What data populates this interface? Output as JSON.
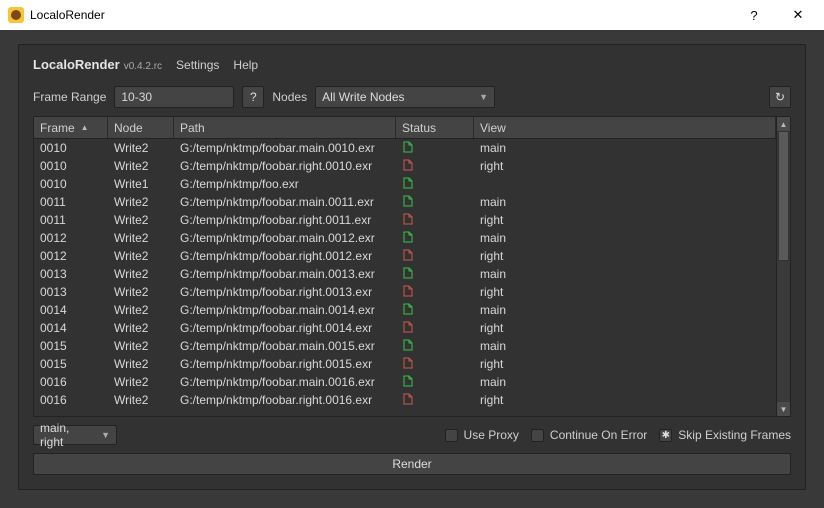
{
  "window": {
    "title": "LocaloRender"
  },
  "header": {
    "app_name": "LocaloRender",
    "version": "v0.4.2.rc",
    "menus": {
      "settings": "Settings",
      "help": "Help"
    }
  },
  "controls": {
    "frame_range_label": "Frame Range",
    "frame_range_value": "10-30",
    "help_glyph": "?",
    "nodes_label": "Nodes",
    "nodes_value": "All Write Nodes",
    "refresh_glyph": "↻"
  },
  "columns": {
    "frame": "Frame",
    "node": "Node",
    "path": "Path",
    "status": "Status",
    "view": "View"
  },
  "rows": [
    {
      "frame": "0010",
      "node": "Write2",
      "path": "G:/temp/nktmp/foobar.main.0010.exr",
      "status": "ok",
      "view": "main"
    },
    {
      "frame": "0010",
      "node": "Write2",
      "path": "G:/temp/nktmp/foobar.right.0010.exr",
      "status": "skip",
      "view": "right"
    },
    {
      "frame": "0010",
      "node": "Write1",
      "path": "G:/temp/nktmp/foo.exr",
      "status": "ok",
      "view": ""
    },
    {
      "frame": "0011",
      "node": "Write2",
      "path": "G:/temp/nktmp/foobar.main.0011.exr",
      "status": "ok",
      "view": "main"
    },
    {
      "frame": "0011",
      "node": "Write2",
      "path": "G:/temp/nktmp/foobar.right.0011.exr",
      "status": "skip",
      "view": "right"
    },
    {
      "frame": "0012",
      "node": "Write2",
      "path": "G:/temp/nktmp/foobar.main.0012.exr",
      "status": "ok",
      "view": "main"
    },
    {
      "frame": "0012",
      "node": "Write2",
      "path": "G:/temp/nktmp/foobar.right.0012.exr",
      "status": "skip",
      "view": "right"
    },
    {
      "frame": "0013",
      "node": "Write2",
      "path": "G:/temp/nktmp/foobar.main.0013.exr",
      "status": "ok",
      "view": "main"
    },
    {
      "frame": "0013",
      "node": "Write2",
      "path": "G:/temp/nktmp/foobar.right.0013.exr",
      "status": "skip",
      "view": "right"
    },
    {
      "frame": "0014",
      "node": "Write2",
      "path": "G:/temp/nktmp/foobar.main.0014.exr",
      "status": "ok",
      "view": "main"
    },
    {
      "frame": "0014",
      "node": "Write2",
      "path": "G:/temp/nktmp/foobar.right.0014.exr",
      "status": "skip",
      "view": "right"
    },
    {
      "frame": "0015",
      "node": "Write2",
      "path": "G:/temp/nktmp/foobar.main.0015.exr",
      "status": "ok",
      "view": "main"
    },
    {
      "frame": "0015",
      "node": "Write2",
      "path": "G:/temp/nktmp/foobar.right.0015.exr",
      "status": "skip",
      "view": "right"
    },
    {
      "frame": "0016",
      "node": "Write2",
      "path": "G:/temp/nktmp/foobar.main.0016.exr",
      "status": "ok",
      "view": "main"
    },
    {
      "frame": "0016",
      "node": "Write2",
      "path": "G:/temp/nktmp/foobar.right.0016.exr",
      "status": "skip",
      "view": "right"
    }
  ],
  "footer": {
    "views_value": "main, right",
    "use_proxy": "Use Proxy",
    "continue_on_error": "Continue On Error",
    "skip_existing": "Skip Existing Frames",
    "skip_existing_checked": true,
    "render": "Render"
  }
}
